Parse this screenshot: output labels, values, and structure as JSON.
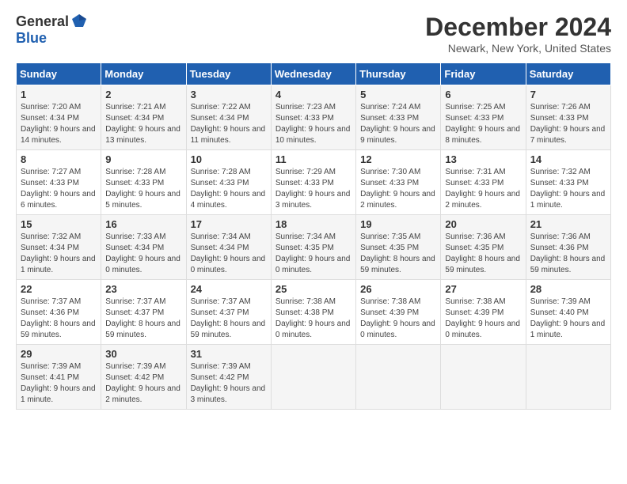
{
  "logo": {
    "general": "General",
    "blue": "Blue"
  },
  "title": "December 2024",
  "location": "Newark, New York, United States",
  "days_of_week": [
    "Sunday",
    "Monday",
    "Tuesday",
    "Wednesday",
    "Thursday",
    "Friday",
    "Saturday"
  ],
  "weeks": [
    [
      {
        "day": "1",
        "sunrise": "Sunrise: 7:20 AM",
        "sunset": "Sunset: 4:34 PM",
        "daylight": "Daylight: 9 hours and 14 minutes."
      },
      {
        "day": "2",
        "sunrise": "Sunrise: 7:21 AM",
        "sunset": "Sunset: 4:34 PM",
        "daylight": "Daylight: 9 hours and 13 minutes."
      },
      {
        "day": "3",
        "sunrise": "Sunrise: 7:22 AM",
        "sunset": "Sunset: 4:34 PM",
        "daylight": "Daylight: 9 hours and 11 minutes."
      },
      {
        "day": "4",
        "sunrise": "Sunrise: 7:23 AM",
        "sunset": "Sunset: 4:33 PM",
        "daylight": "Daylight: 9 hours and 10 minutes."
      },
      {
        "day": "5",
        "sunrise": "Sunrise: 7:24 AM",
        "sunset": "Sunset: 4:33 PM",
        "daylight": "Daylight: 9 hours and 9 minutes."
      },
      {
        "day": "6",
        "sunrise": "Sunrise: 7:25 AM",
        "sunset": "Sunset: 4:33 PM",
        "daylight": "Daylight: 9 hours and 8 minutes."
      },
      {
        "day": "7",
        "sunrise": "Sunrise: 7:26 AM",
        "sunset": "Sunset: 4:33 PM",
        "daylight": "Daylight: 9 hours and 7 minutes."
      }
    ],
    [
      {
        "day": "8",
        "sunrise": "Sunrise: 7:27 AM",
        "sunset": "Sunset: 4:33 PM",
        "daylight": "Daylight: 9 hours and 6 minutes."
      },
      {
        "day": "9",
        "sunrise": "Sunrise: 7:28 AM",
        "sunset": "Sunset: 4:33 PM",
        "daylight": "Daylight: 9 hours and 5 minutes."
      },
      {
        "day": "10",
        "sunrise": "Sunrise: 7:28 AM",
        "sunset": "Sunset: 4:33 PM",
        "daylight": "Daylight: 9 hours and 4 minutes."
      },
      {
        "day": "11",
        "sunrise": "Sunrise: 7:29 AM",
        "sunset": "Sunset: 4:33 PM",
        "daylight": "Daylight: 9 hours and 3 minutes."
      },
      {
        "day": "12",
        "sunrise": "Sunrise: 7:30 AM",
        "sunset": "Sunset: 4:33 PM",
        "daylight": "Daylight: 9 hours and 2 minutes."
      },
      {
        "day": "13",
        "sunrise": "Sunrise: 7:31 AM",
        "sunset": "Sunset: 4:33 PM",
        "daylight": "Daylight: 9 hours and 2 minutes."
      },
      {
        "day": "14",
        "sunrise": "Sunrise: 7:32 AM",
        "sunset": "Sunset: 4:33 PM",
        "daylight": "Daylight: 9 hours and 1 minute."
      }
    ],
    [
      {
        "day": "15",
        "sunrise": "Sunrise: 7:32 AM",
        "sunset": "Sunset: 4:34 PM",
        "daylight": "Daylight: 9 hours and 1 minute."
      },
      {
        "day": "16",
        "sunrise": "Sunrise: 7:33 AM",
        "sunset": "Sunset: 4:34 PM",
        "daylight": "Daylight: 9 hours and 0 minutes."
      },
      {
        "day": "17",
        "sunrise": "Sunrise: 7:34 AM",
        "sunset": "Sunset: 4:34 PM",
        "daylight": "Daylight: 9 hours and 0 minutes."
      },
      {
        "day": "18",
        "sunrise": "Sunrise: 7:34 AM",
        "sunset": "Sunset: 4:35 PM",
        "daylight": "Daylight: 9 hours and 0 minutes."
      },
      {
        "day": "19",
        "sunrise": "Sunrise: 7:35 AM",
        "sunset": "Sunset: 4:35 PM",
        "daylight": "Daylight: 8 hours and 59 minutes."
      },
      {
        "day": "20",
        "sunrise": "Sunrise: 7:36 AM",
        "sunset": "Sunset: 4:35 PM",
        "daylight": "Daylight: 8 hours and 59 minutes."
      },
      {
        "day": "21",
        "sunrise": "Sunrise: 7:36 AM",
        "sunset": "Sunset: 4:36 PM",
        "daylight": "Daylight: 8 hours and 59 minutes."
      }
    ],
    [
      {
        "day": "22",
        "sunrise": "Sunrise: 7:37 AM",
        "sunset": "Sunset: 4:36 PM",
        "daylight": "Daylight: 8 hours and 59 minutes."
      },
      {
        "day": "23",
        "sunrise": "Sunrise: 7:37 AM",
        "sunset": "Sunset: 4:37 PM",
        "daylight": "Daylight: 8 hours and 59 minutes."
      },
      {
        "day": "24",
        "sunrise": "Sunrise: 7:37 AM",
        "sunset": "Sunset: 4:37 PM",
        "daylight": "Daylight: 8 hours and 59 minutes."
      },
      {
        "day": "25",
        "sunrise": "Sunrise: 7:38 AM",
        "sunset": "Sunset: 4:38 PM",
        "daylight": "Daylight: 9 hours and 0 minutes."
      },
      {
        "day": "26",
        "sunrise": "Sunrise: 7:38 AM",
        "sunset": "Sunset: 4:39 PM",
        "daylight": "Daylight: 9 hours and 0 minutes."
      },
      {
        "day": "27",
        "sunrise": "Sunrise: 7:38 AM",
        "sunset": "Sunset: 4:39 PM",
        "daylight": "Daylight: 9 hours and 0 minutes."
      },
      {
        "day": "28",
        "sunrise": "Sunrise: 7:39 AM",
        "sunset": "Sunset: 4:40 PM",
        "daylight": "Daylight: 9 hours and 1 minute."
      }
    ],
    [
      {
        "day": "29",
        "sunrise": "Sunrise: 7:39 AM",
        "sunset": "Sunset: 4:41 PM",
        "daylight": "Daylight: 9 hours and 1 minute."
      },
      {
        "day": "30",
        "sunrise": "Sunrise: 7:39 AM",
        "sunset": "Sunset: 4:42 PM",
        "daylight": "Daylight: 9 hours and 2 minutes."
      },
      {
        "day": "31",
        "sunrise": "Sunrise: 7:39 AM",
        "sunset": "Sunset: 4:42 PM",
        "daylight": "Daylight: 9 hours and 3 minutes."
      },
      null,
      null,
      null,
      null
    ]
  ]
}
